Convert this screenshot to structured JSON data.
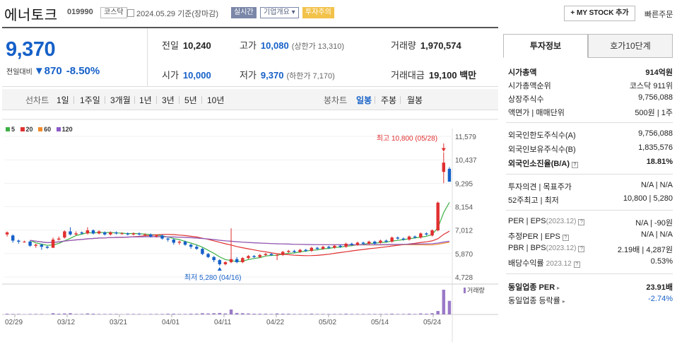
{
  "stock": {
    "name": "에너토크",
    "code": "019990",
    "market": "코스닥",
    "date": "2024.05.29 기준(장마감)",
    "tags": {
      "realtime": "실시간",
      "company": "기업개요 ▾",
      "warning": "투자주의"
    }
  },
  "header": {
    "mystock": "+ MY STOCK 추가",
    "fast_order": "빠른주문"
  },
  "price": {
    "current": "9,370",
    "change_label": "전일대비",
    "change_arrow": "▼",
    "change": "870",
    "change_pct": "-8.50%"
  },
  "quote": {
    "prev_label": "전일",
    "prev": "10,240",
    "open_label": "시가",
    "open": "10,000",
    "high_label": "고가",
    "high": "10,080",
    "upper_limit": "(상한가 13,310)",
    "low_label": "저가",
    "low": "9,370",
    "lower_limit": "(하한가 7,170)",
    "volume_label": "거래량",
    "volume": "1,970,574",
    "amount_label": "거래대금",
    "amount": "19,100 백만"
  },
  "chart_tabs": {
    "line_label": "선차트",
    "periods": [
      "1일",
      "1주일",
      "3개월",
      "1년",
      "3년",
      "5년",
      "10년"
    ],
    "candle_label": "봉차트",
    "candles": [
      "일봉",
      "주봉",
      "월봉"
    ],
    "active_candle": "일봉"
  },
  "legend": [
    {
      "label": "5",
      "color": "#3cb043"
    },
    {
      "label": "20",
      "color": "#e03030"
    },
    {
      "label": "60",
      "color": "#f08a2a"
    },
    {
      "label": "120",
      "color": "#8a5ac8"
    }
  ],
  "chart_data": {
    "type": "candlestick",
    "ylim": [
      4728,
      11579
    ],
    "y_ticks": [
      "11,579",
      "10,437",
      "9,295",
      "8,154",
      "7,012",
      "5,870",
      "4,728"
    ],
    "x_labels": [
      "02/29",
      "03/12",
      "03/21",
      "04/01",
      "04/11",
      "04/22",
      "05/02",
      "05/14",
      "05/24"
    ],
    "annotations": {
      "high": "최고 10,800 (05/28)",
      "low": "최저 5,280 (04/16)"
    },
    "volume_label": "거래량",
    "candles": [
      {
        "o": 6800,
        "c": 6900,
        "h": 6950,
        "l": 6700
      },
      {
        "o": 6750,
        "c": 6500,
        "h": 6800,
        "l": 6400
      },
      {
        "o": 6500,
        "c": 6450,
        "h": 6550,
        "l": 6350
      },
      {
        "o": 6450,
        "c": 6450,
        "h": 6500,
        "l": 6400
      },
      {
        "o": 6450,
        "c": 6250,
        "h": 6500,
        "l": 6200
      },
      {
        "o": 6250,
        "c": 6300,
        "h": 6350,
        "l": 6150
      },
      {
        "o": 6300,
        "c": 6200,
        "h": 6350,
        "l": 6050
      },
      {
        "o": 6200,
        "c": 6150,
        "h": 6250,
        "l": 6100
      },
      {
        "o": 6150,
        "c": 6550,
        "h": 6650,
        "l": 6150
      },
      {
        "o": 6550,
        "c": 6600,
        "h": 6700,
        "l": 6500
      },
      {
        "o": 6650,
        "c": 6950,
        "h": 7000,
        "l": 6600
      },
      {
        "o": 6950,
        "c": 6800,
        "h": 7150,
        "l": 6750
      },
      {
        "o": 6800,
        "c": 6850,
        "h": 6950,
        "l": 6750
      },
      {
        "o": 6900,
        "c": 6850,
        "h": 6950,
        "l": 6800
      },
      {
        "o": 6850,
        "c": 7000,
        "h": 7150,
        "l": 6800
      },
      {
        "o": 7000,
        "c": 6850,
        "h": 7050,
        "l": 6800
      },
      {
        "o": 6850,
        "c": 6950,
        "h": 7000,
        "l": 6800
      },
      {
        "o": 6900,
        "c": 6800,
        "h": 6950,
        "l": 6750
      },
      {
        "o": 6800,
        "c": 6900,
        "h": 6950,
        "l": 6750
      },
      {
        "o": 6900,
        "c": 6850,
        "h": 6950,
        "l": 6800
      },
      {
        "o": 6850,
        "c": 6850,
        "h": 6900,
        "l": 6800
      },
      {
        "o": 6850,
        "c": 6800,
        "h": 6900,
        "l": 6750
      },
      {
        "o": 6800,
        "c": 6850,
        "h": 6900,
        "l": 6750
      },
      {
        "o": 6850,
        "c": 6800,
        "h": 6900,
        "l": 6750
      },
      {
        "o": 6800,
        "c": 6800,
        "h": 6850,
        "l": 6750
      },
      {
        "o": 6800,
        "c": 6700,
        "h": 6850,
        "l": 6650
      },
      {
        "o": 6700,
        "c": 6750,
        "h": 6800,
        "l": 6650
      },
      {
        "o": 6750,
        "c": 6600,
        "h": 6800,
        "l": 6550
      },
      {
        "o": 6600,
        "c": 6550,
        "h": 6650,
        "l": 6450
      },
      {
        "o": 6550,
        "c": 6400,
        "h": 6600,
        "l": 6300
      },
      {
        "o": 6400,
        "c": 6450,
        "h": 6500,
        "l": 6300
      },
      {
        "o": 6450,
        "c": 6300,
        "h": 6500,
        "l": 6250
      },
      {
        "o": 6300,
        "c": 6200,
        "h": 6350,
        "l": 6100
      },
      {
        "o": 6200,
        "c": 6100,
        "h": 6300,
        "l": 6050
      },
      {
        "o": 6100,
        "c": 5850,
        "h": 6150,
        "l": 5800
      },
      {
        "o": 5850,
        "c": 5700,
        "h": 5900,
        "l": 5650
      },
      {
        "o": 5700,
        "c": 5550,
        "h": 5750,
        "l": 5450
      },
      {
        "o": 5550,
        "c": 5350,
        "h": 5600,
        "l": 5280
      },
      {
        "o": 5350,
        "c": 5450,
        "h": 5500,
        "l": 5300
      },
      {
        "o": 5450,
        "c": 5600,
        "h": 7100,
        "l": 5400
      },
      {
        "o": 5600,
        "c": 5450,
        "h": 5700,
        "l": 5400
      },
      {
        "o": 5450,
        "c": 5650,
        "h": 5700,
        "l": 5400
      },
      {
        "o": 5650,
        "c": 5750,
        "h": 5800,
        "l": 5600
      },
      {
        "o": 5750,
        "c": 5700,
        "h": 5800,
        "l": 5650
      },
      {
        "o": 5700,
        "c": 5800,
        "h": 5850,
        "l": 5650
      },
      {
        "o": 5800,
        "c": 5850,
        "h": 5900,
        "l": 5750
      },
      {
        "o": 5850,
        "c": 5800,
        "h": 5900,
        "l": 5750
      },
      {
        "o": 5800,
        "c": 5800,
        "h": 5850,
        "l": 5550
      },
      {
        "o": 5800,
        "c": 5950,
        "h": 6000,
        "l": 5750
      },
      {
        "o": 5950,
        "c": 6000,
        "h": 6050,
        "l": 5900
      },
      {
        "o": 6000,
        "c": 5950,
        "h": 6050,
        "l": 5900
      },
      {
        "o": 5950,
        "c": 6050,
        "h": 6100,
        "l": 5900
      },
      {
        "o": 6050,
        "c": 6000,
        "h": 6100,
        "l": 5950
      },
      {
        "o": 6000,
        "c": 6150,
        "h": 6200,
        "l": 5950
      },
      {
        "o": 6150,
        "c": 6100,
        "h": 6200,
        "l": 6050
      },
      {
        "o": 6100,
        "c": 6200,
        "h": 6250,
        "l": 6050
      },
      {
        "o": 6200,
        "c": 6150,
        "h": 6250,
        "l": 6100
      },
      {
        "o": 6150,
        "c": 6250,
        "h": 6300,
        "l": 6100
      },
      {
        "o": 6250,
        "c": 6200,
        "h": 6300,
        "l": 6150
      },
      {
        "o": 6200,
        "c": 6350,
        "h": 6400,
        "l": 6150
      },
      {
        "o": 6350,
        "c": 6300,
        "h": 6400,
        "l": 6250
      },
      {
        "o": 6300,
        "c": 6400,
        "h": 6450,
        "l": 6250
      },
      {
        "o": 6400,
        "c": 6350,
        "h": 6450,
        "l": 6300
      },
      {
        "o": 6350,
        "c": 6450,
        "h": 6500,
        "l": 6300
      },
      {
        "o": 6450,
        "c": 6350,
        "h": 6500,
        "l": 6300
      },
      {
        "o": 6400,
        "c": 6500,
        "h": 6550,
        "l": 6350
      },
      {
        "o": 6500,
        "c": 6450,
        "h": 6550,
        "l": 6400
      },
      {
        "o": 6450,
        "c": 6650,
        "h": 6700,
        "l": 6400
      },
      {
        "o": 6650,
        "c": 6600,
        "h": 6700,
        "l": 6550
      },
      {
        "o": 6600,
        "c": 6550,
        "h": 6650,
        "l": 6500
      },
      {
        "o": 6550,
        "c": 6700,
        "h": 6750,
        "l": 6500
      },
      {
        "o": 6700,
        "c": 6650,
        "h": 6750,
        "l": 6600
      },
      {
        "o": 6650,
        "c": 6850,
        "h": 6900,
        "l": 6600
      },
      {
        "o": 6850,
        "c": 6800,
        "h": 6900,
        "l": 6750
      },
      {
        "o": 6750,
        "c": 7000,
        "h": 7050,
        "l": 6700
      },
      {
        "o": 7000,
        "c": 8350,
        "h": 8400,
        "l": 6950
      },
      {
        "o": 9850,
        "c": 10300,
        "h": 10800,
        "l": 9300
      },
      {
        "o": 10000,
        "c": 9370,
        "h": 10080,
        "l": 9370
      }
    ],
    "volumes": [
      3,
      2,
      2,
      1,
      2,
      2,
      2,
      1,
      5,
      3,
      4,
      5,
      2,
      2,
      4,
      3,
      2,
      2,
      2,
      2,
      1,
      2,
      2,
      2,
      1,
      2,
      2,
      2,
      3,
      3,
      2,
      2,
      3,
      3,
      5,
      4,
      5,
      6,
      4,
      20,
      6,
      5,
      4,
      3,
      3,
      3,
      2,
      4,
      3,
      3,
      2,
      2,
      2,
      3,
      2,
      2,
      2,
      2,
      2,
      3,
      2,
      2,
      2,
      2,
      2,
      2,
      2,
      3,
      2,
      2,
      3,
      2,
      4,
      3,
      5,
      14,
      100,
      55
    ]
  },
  "panel": {
    "tabs": [
      "투자정보",
      "호가10단계"
    ],
    "market_cap_label": "시가총액",
    "market_cap": "914억원",
    "cap_rank_label": "시가총액순위",
    "cap_rank": "코스닥 911위",
    "shares_label": "상장주식수",
    "shares": "9,756,088",
    "par_label": "액면가 | 매매단위",
    "par": "500원 | 1주",
    "foreign_limit_label": "외국인한도주식수(A)",
    "foreign_limit": "9,756,088",
    "foreign_hold_label": "외국인보유주식수(B)",
    "foreign_hold": "1,835,576",
    "foreign_ratio_label": "외국인소진율(B/A)",
    "foreign_ratio": "18.81%",
    "opinion_label": "투자의견 | 목표주가",
    "opinion": "N/A | N/A",
    "week52_label": "52주최고 | 최저",
    "week52": "10,800 | 5,280",
    "per_label": "PER | EPS",
    "per_sub": "(2023.12)",
    "per": "N/A | -90원",
    "est_per_label": "추정PER | EPS",
    "est_per": "N/A | N/A",
    "pbr_label": "PBR | BPS",
    "pbr_sub": "(2023.12)",
    "pbr": "2.19배 | 4,287원",
    "div_label": "배당수익률",
    "div_sub": "2023.12",
    "div": "0.53%",
    "ind_per_label": "동일업종 PER",
    "ind_per": "23.91배",
    "ind_rate_label": "동일업종 등락률",
    "ind_rate": "-2.74%"
  }
}
